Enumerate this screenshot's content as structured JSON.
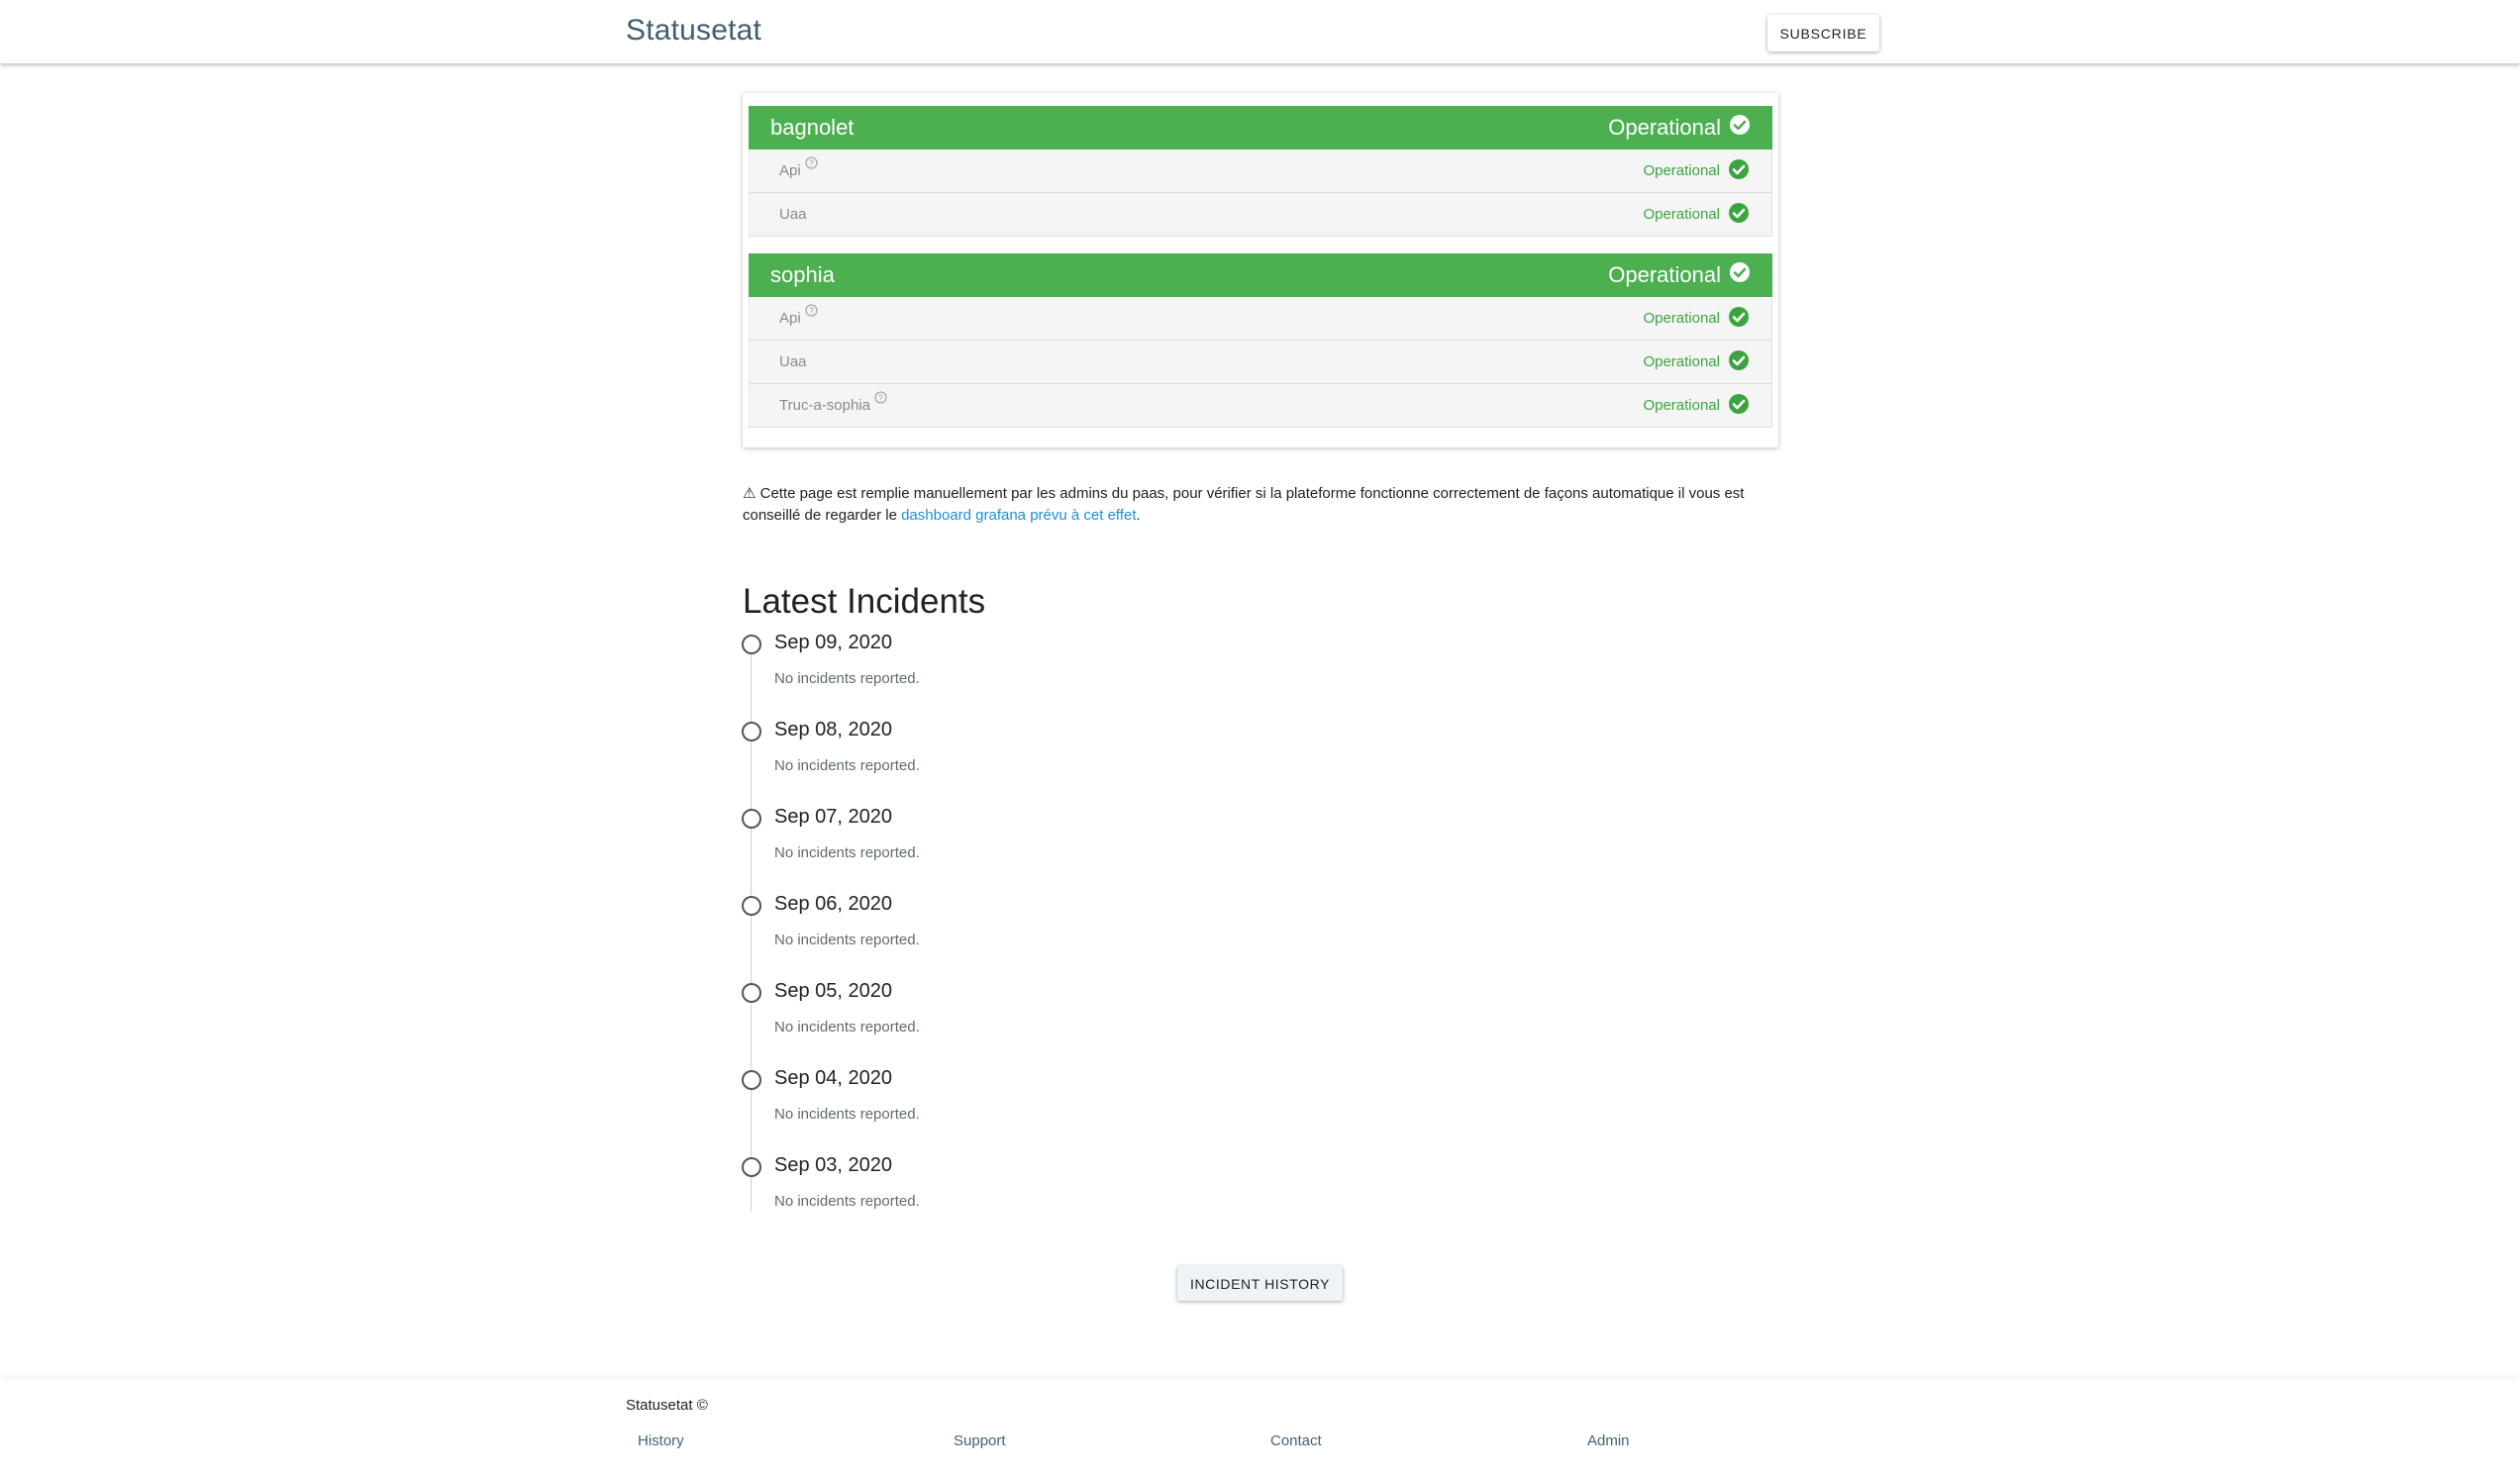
{
  "header": {
    "brand": "Statusetat",
    "subscribe_label": "SUBSCRIBE"
  },
  "groups": [
    {
      "name": "bagnolet",
      "status": "Operational",
      "services": [
        {
          "name": "Api",
          "status": "Operational",
          "help": true
        },
        {
          "name": "Uaa",
          "status": "Operational",
          "help": false
        }
      ]
    },
    {
      "name": "sophia",
      "status": "Operational",
      "services": [
        {
          "name": "Api",
          "status": "Operational",
          "help": true
        },
        {
          "name": "Uaa",
          "status": "Operational",
          "help": false
        },
        {
          "name": "Truc-a-sophia",
          "status": "Operational",
          "help": true
        }
      ]
    }
  ],
  "notice": {
    "icon": "warning-icon",
    "text_before": "⚠ Cette page est remplie manuellement par les admins du paas, pour vérifier si la plateforme fonctionne correctement de façons automatique il vous est conseillé de regarder le ",
    "link_text": "dashboard grafana prévu à cet effet",
    "text_after": "."
  },
  "incidents": {
    "title": "Latest Incidents",
    "items": [
      {
        "date": "Sep 09, 2020",
        "message": "No incidents reported."
      },
      {
        "date": "Sep 08, 2020",
        "message": "No incidents reported."
      },
      {
        "date": "Sep 07, 2020",
        "message": "No incidents reported."
      },
      {
        "date": "Sep 06, 2020",
        "message": "No incidents reported."
      },
      {
        "date": "Sep 05, 2020",
        "message": "No incidents reported."
      },
      {
        "date": "Sep 04, 2020",
        "message": "No incidents reported."
      },
      {
        "date": "Sep 03, 2020",
        "message": "No incidents reported."
      }
    ],
    "history_button_label": "INCIDENT HISTORY"
  },
  "footer": {
    "brand": "Statusetat ©",
    "links": [
      "History",
      "Support",
      "Contact",
      "Admin"
    ]
  },
  "colors": {
    "operational_green": "#4caf50",
    "status_text_green": "#3ca43f",
    "link_blue": "#1f8fd4",
    "brand_slate": "#3f5f6f"
  }
}
